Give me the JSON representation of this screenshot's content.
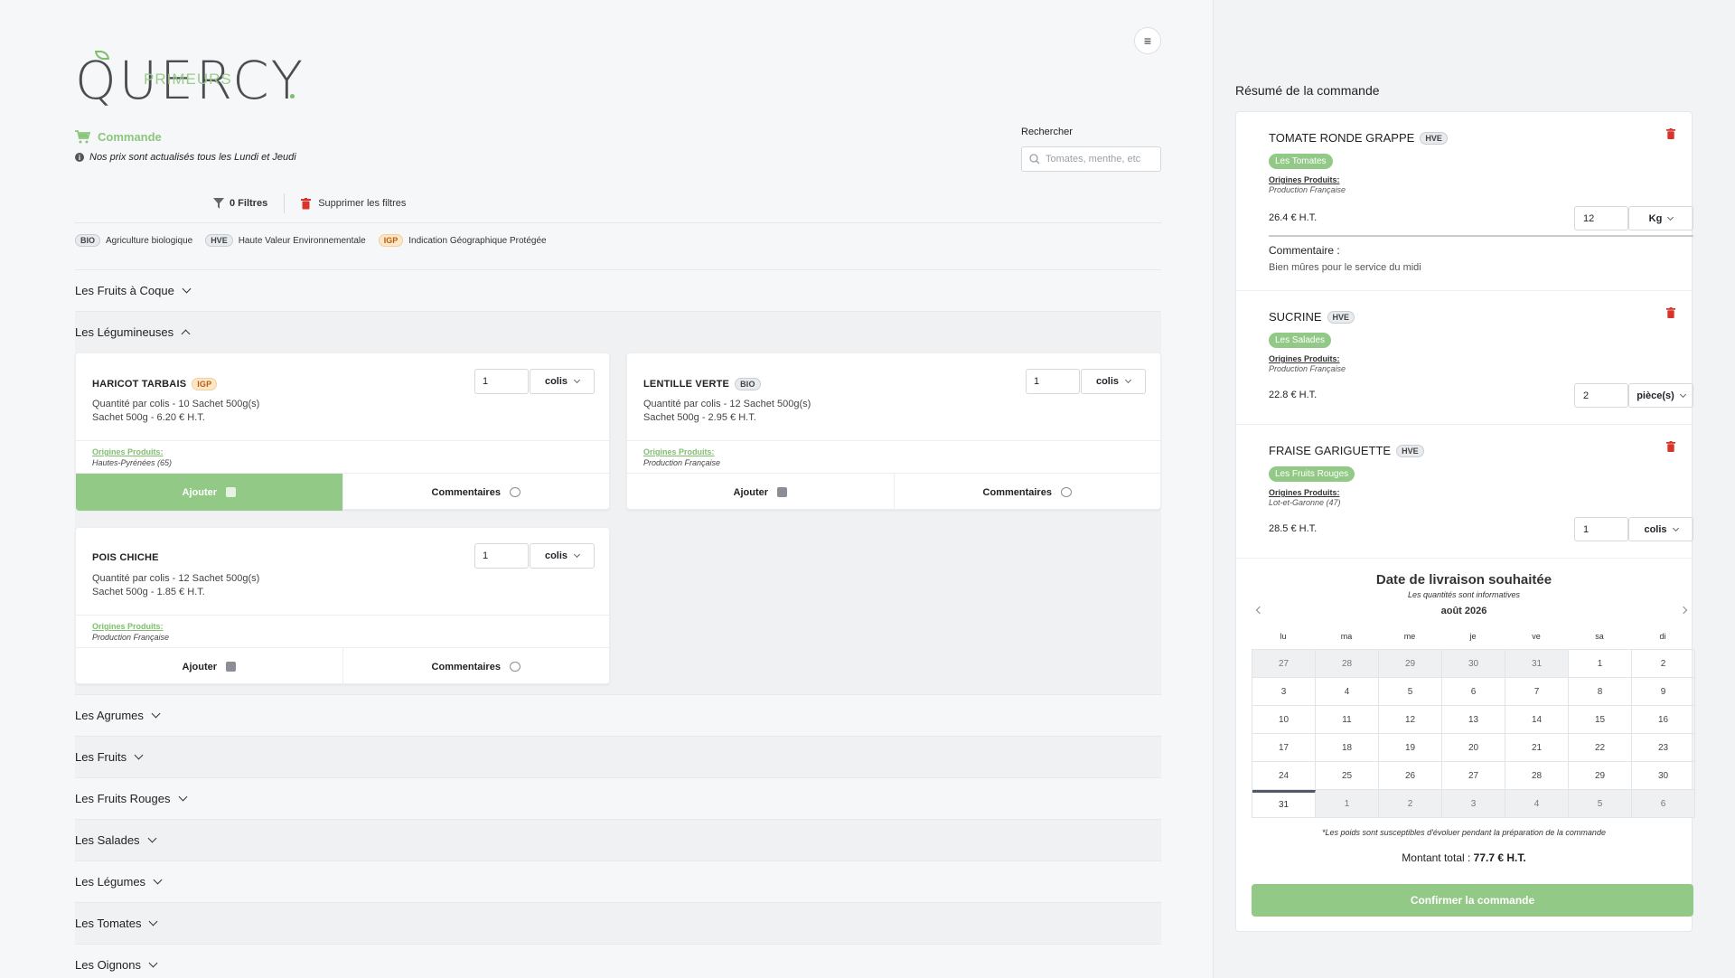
{
  "brand": {
    "name": "QUERCY",
    "sub": "PRIMEURS"
  },
  "header": {
    "commande_label": "Commande",
    "notice": "Nos prix sont actualisés tous les Lundi et Jeudi",
    "search_label": "Rechercher",
    "search_placeholder": "Tomates, menthe, etc",
    "filters_label": "0 Filtres",
    "clear_filters": "Supprimer les filtres"
  },
  "legend": [
    {
      "code": "BIO",
      "label": "Agriculture biologique"
    },
    {
      "code": "HVE",
      "label": "Haute Valeur Environnementale"
    },
    {
      "code": "IGP",
      "label": "Indication Géographique Protégée"
    }
  ],
  "categories": {
    "fruits_coque": "Les Fruits à Coque",
    "legumineuses": "Les Légumineuses",
    "agrumes": "Les Agrumes",
    "fruits": "Les Fruits",
    "fruits_rouges": "Les Fruits Rouges",
    "salades": "Les Salades",
    "legumes": "Les Légumes",
    "tomates": "Les Tomates",
    "oignons": "Les Oignons"
  },
  "products": [
    {
      "name": "HARICOT TARBAIS",
      "badge": "IGP",
      "qty": "1",
      "unit": "colis",
      "line1": "Quantité par colis - 10 Sachet 500g(s)",
      "line2": "Sachet 500g - 6.20 € H.T.",
      "origins_label": "Origines Produits:",
      "origins": "Hautes-Pyrénées (65)",
      "add": "Ajouter",
      "comments": "Commentaires"
    },
    {
      "name": "LENTILLE VERTE",
      "badge": "BIO",
      "qty": "1",
      "unit": "colis",
      "line1": "Quantité par colis - 12 Sachet 500g(s)",
      "line2": "Sachet 500g - 2.95 € H.T.",
      "origins_label": "Origines Produits:",
      "origins": "Production Française",
      "add": "Ajouter",
      "comments": "Commentaires"
    },
    {
      "name": "POIS CHICHE",
      "badge": "",
      "qty": "1",
      "unit": "colis",
      "line1": "Quantité par colis - 12 Sachet 500g(s)",
      "line2": "Sachet 500g - 1.85 € H.T.",
      "origins_label": "Origines Produits:",
      "origins": "Production Française",
      "add": "Ajouter",
      "comments": "Commentaires"
    }
  ],
  "summary": {
    "title": "Résumé de la commande",
    "items": [
      {
        "name": "TOMATE RONDE GRAPPE",
        "badge": "HVE",
        "category": "Les Tomates",
        "origins_label": "Origines Produits:",
        "origins": "Production Française",
        "price": "26.4 € H.T.",
        "qty": "12",
        "unit": "Kg",
        "comment_label": "Commentaire :",
        "comment": "Bien mûres pour le service du midi"
      },
      {
        "name": "SUCRINE",
        "badge": "HVE",
        "category": "Les Salades",
        "origins_label": "Origines Produits:",
        "origins": "Production Française",
        "price": "22.8 € H.T.",
        "qty": "2",
        "unit": "pièce(s)"
      },
      {
        "name": "FRAISE GARIGUETTE",
        "badge": "HVE",
        "category": "Les Fruits Rouges",
        "origins_label": "Origines Produits:",
        "origins": "Lot-et-Garonne (47)",
        "price": "28.5 € H.T.",
        "qty": "1",
        "unit": "colis"
      }
    ],
    "calendar": {
      "title": "Date de livraison souhaitée",
      "subtitle": "Les quantités sont informatives",
      "month": "août 2026",
      "weekdays": [
        "lu",
        "ma",
        "me",
        "je",
        "ve",
        "sa",
        "di"
      ],
      "days": [
        "27",
        "28",
        "29",
        "30",
        "31",
        "1",
        "2",
        "3",
        "4",
        "5",
        "6",
        "7",
        "8",
        "9",
        "10",
        "11",
        "12",
        "13",
        "14",
        "15",
        "16",
        "17",
        "18",
        "19",
        "20",
        "21",
        "22",
        "23",
        "24",
        "25",
        "26",
        "27",
        "28",
        "29",
        "30",
        "31",
        "1",
        "2",
        "3",
        "4",
        "5",
        "6"
      ],
      "note": "*Les poids sont susceptibles d'évoluer pendant la préparation de la commande"
    },
    "total_label": "Montant total :",
    "total_value": "77.7 € H.T.",
    "confirm": "Confirmer la commande"
  }
}
